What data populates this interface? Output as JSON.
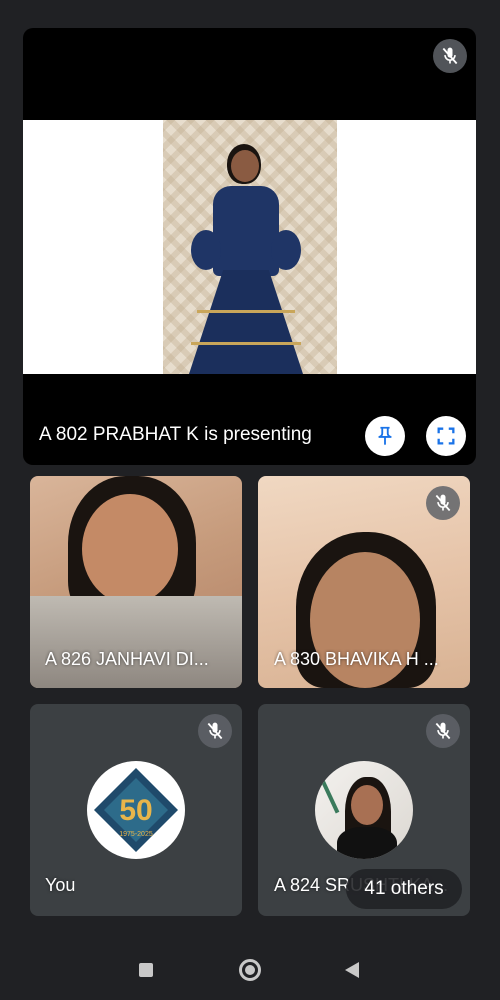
{
  "presenter": {
    "label": "A 802 PRABHAT K is presenting",
    "muted": true,
    "buttons": {
      "pin_icon": "pin-icon",
      "fullscreen_icon": "fullscreen-icon"
    }
  },
  "participants": [
    {
      "name": "A 826 JANHAVI DI...",
      "muted": false,
      "video": true
    },
    {
      "name": "A 830 BHAVIKA H ...",
      "muted": true,
      "video": true
    },
    {
      "name": "You",
      "muted": true,
      "video": false,
      "avatar": "logo-50-years"
    },
    {
      "name": "A 824 SRUSHTI KA...",
      "muted": true,
      "video": false,
      "avatar": "profile-photo"
    }
  ],
  "badge": {
    "logo_text": "50",
    "logo_years": "1975-2025"
  },
  "others_chip": "41 others",
  "nav": {
    "recents_icon": "square-icon",
    "home_icon": "circle-icon",
    "back_icon": "triangle-back-icon"
  },
  "colors": {
    "background": "#202124",
    "tile": "#3c4043",
    "accent_blue": "#1a73e8"
  }
}
